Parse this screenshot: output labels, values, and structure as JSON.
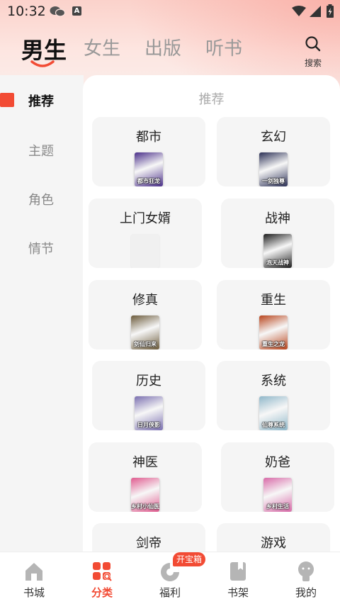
{
  "status_bar": {
    "time": "10:32",
    "a_label": "A"
  },
  "top_tabs": [
    {
      "label": "男生",
      "active": true
    },
    {
      "label": "女生",
      "active": false
    },
    {
      "label": "出版",
      "active": false
    },
    {
      "label": "听书",
      "active": false
    }
  ],
  "search": {
    "label": "搜索"
  },
  "side_nav": [
    {
      "label": "推荐",
      "active": true
    },
    {
      "label": "主题",
      "active": false
    },
    {
      "label": "角色",
      "active": false
    },
    {
      "label": "情节",
      "active": false
    }
  ],
  "section_title": "推荐",
  "categories": [
    {
      "label": "都市",
      "cover_text": "都市狂龙",
      "cover_color": "#4a2f8a"
    },
    {
      "label": "玄幻",
      "cover_text": "一剑独尊",
      "cover_color": "#2a2f55"
    },
    {
      "label": "上门女婿",
      "cover_text": "",
      "cover_color": "#eeeeee"
    },
    {
      "label": "战神",
      "cover_text": "泡天战神",
      "cover_color": "#1c1c1c"
    },
    {
      "label": "修真",
      "cover_text": "剑仙归来",
      "cover_color": "#6b5a3a"
    },
    {
      "label": "重生",
      "cover_text": "重生之龙",
      "cover_color": "#b8441c"
    },
    {
      "label": "历史",
      "cover_text": "日月侠影",
      "cover_color": "#7a6fb0"
    },
    {
      "label": "系统",
      "cover_text": "仙尊系统",
      "cover_color": "#8fb7c9"
    },
    {
      "label": "神医",
      "cover_text": "乡村小仙医",
      "cover_color": "#e05b8f"
    },
    {
      "label": "奶爸",
      "cover_text": "乡村生活",
      "cover_color": "#d86aa8"
    },
    {
      "label": "剑帝",
      "cover_text": "",
      "cover_color": "#eeeeee"
    },
    {
      "label": "游戏",
      "cover_text": "",
      "cover_color": "#eeeeee"
    }
  ],
  "bottom_nav": [
    {
      "label": "书城",
      "active": false
    },
    {
      "label": "分类",
      "active": true
    },
    {
      "label": "福利",
      "active": false
    },
    {
      "label": "书架",
      "active": false
    },
    {
      "label": "我的",
      "active": false
    }
  ],
  "welfare_badge": "开宝箱",
  "colors": {
    "accent": "#f24b34",
    "gray_text": "#888888"
  }
}
